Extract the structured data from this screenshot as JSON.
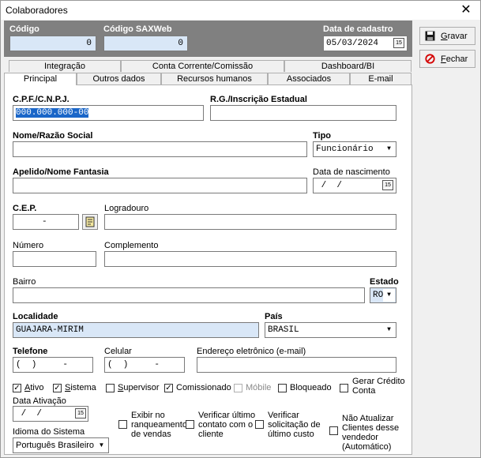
{
  "window": {
    "title": "Colaboradores"
  },
  "header": {
    "codigo_label": "Código",
    "codigo_value": "0",
    "saxweb_label": "Código SAXWeb",
    "saxweb_value": "0",
    "data_label": "Data de cadastro",
    "data_value": "05/03/2024"
  },
  "buttons": {
    "gravar_first": "G",
    "gravar_rest": "ravar",
    "fechar_first": "F",
    "fechar_rest": "echar"
  },
  "tabs_top": [
    "Integração",
    "Conta Corrente/Comissão",
    "Dashboard/BI"
  ],
  "tabs_bottom": [
    "Principal",
    "Outros dados",
    "Recursos humanos",
    "Associados",
    "E-mail"
  ],
  "form": {
    "cpf_label": "C.P.F./C.N.P.J.",
    "cpf_value": "000.000.000-00",
    "rg_label": "R.G./Inscrição Estadual",
    "rg_value": "",
    "nome_label": "Nome/Razão Social",
    "nome_value": "",
    "tipo_label": "Tipo",
    "tipo_value": "Funcionário",
    "apelido_label": "Apelido/Nome Fantasia",
    "apelido_value": "",
    "nascimento_label": "Data de nascimento",
    "nascimento_value": " /  /",
    "cep_label": "C.E.P.",
    "cep_value": "     -",
    "logradouro_label": "Logradouro",
    "logradouro_value": "",
    "numero_label": "Número",
    "numero_value": "",
    "complemento_label": "Complemento",
    "complemento_value": "",
    "bairro_label": "Bairro",
    "bairro_value": "",
    "estado_label": "Estado",
    "estado_value": "RO",
    "localidade_label": "Localidade",
    "localidade_value": "GUAJARA-MIRIM",
    "pais_label": "País",
    "pais_value": "BRASIL",
    "telefone_label": "Telefone",
    "telefone_value": "(  )     -",
    "celular_label": "Celular",
    "celular_value": "(  )     -",
    "email_label": "Endereço eletrônico (e-mail)",
    "email_value": "",
    "ativacao_label": "Data Ativação",
    "ativacao_value": " /  /",
    "idioma_label": "Idioma do Sistema",
    "idioma_value": "Português Brasileiro"
  },
  "checks": {
    "ativo": {
      "first": "A",
      "rest": "tivo",
      "checked": true
    },
    "sistema": {
      "first": "S",
      "rest": "istema",
      "checked": true
    },
    "supervisor": {
      "first": "S",
      "rest": "upervisor",
      "checked": false
    },
    "comissionado": {
      "label": "Comissionado",
      "checked": true
    },
    "movel": {
      "label": "Móbile",
      "checked": false
    },
    "bloqueado": {
      "label": "Bloqueado",
      "checked": false
    },
    "gerar_credito": {
      "line1": "Gerar Crédito",
      "line2": "Conta",
      "checked": false
    },
    "exibir": {
      "line1": "Exibir no",
      "line2": "ranqueamento",
      "line3": "de vendas",
      "checked": false
    },
    "verificar_contato": {
      "line1": "Verificar último",
      "line2": "contato com o",
      "line3": "cliente",
      "checked": false
    },
    "verificar_custo": {
      "line1": "Verificar",
      "line2": "solicitação de",
      "line3": "último custo",
      "checked": false
    },
    "nao_atualizar": {
      "line1": "Não Atualizar",
      "line2": "Clientes desse",
      "line3": "vendedor",
      "line4": "(Automático)",
      "checked": false
    }
  }
}
